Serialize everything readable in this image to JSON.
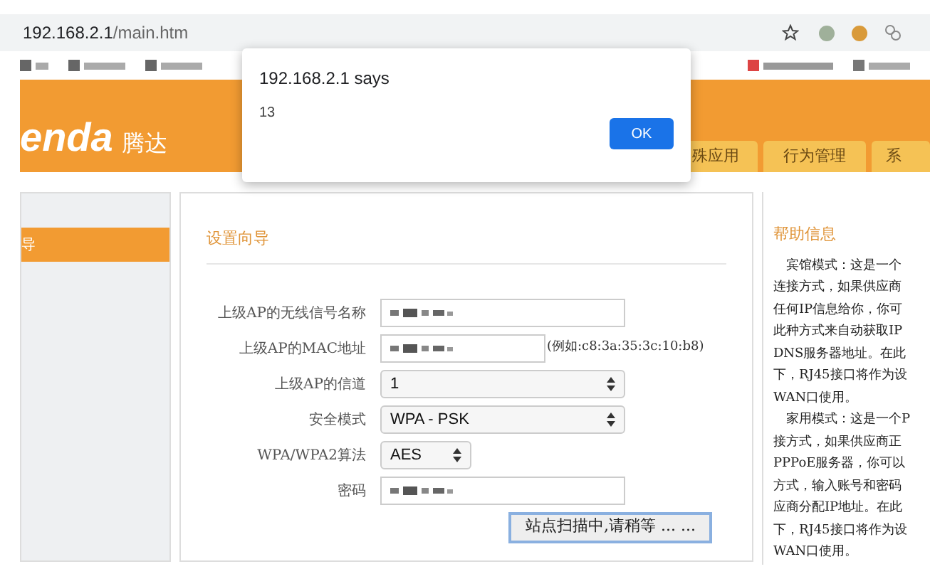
{
  "browser": {
    "url_host": "192.168.2.1",
    "url_path": "/main.htm"
  },
  "header": {
    "logo": "enda",
    "logo_cn": "腾达"
  },
  "tabs": [
    {
      "label": "殊应用",
      "selected": false
    },
    {
      "label": "行为管理",
      "selected": false
    },
    {
      "label": "系",
      "selected": false
    }
  ],
  "sidebar": {
    "items": [
      {
        "label": "导",
        "selected": true
      }
    ]
  },
  "form": {
    "title": "设置向导",
    "fields": [
      {
        "kind": "text",
        "label": "上级AP的无线信号名称",
        "blurred": true
      },
      {
        "kind": "text",
        "label": "上级AP的MAC地址",
        "blurred": true,
        "hint": "(例如:c8:3a:35:3c:10:b8)"
      },
      {
        "kind": "select",
        "label": "上级AP的信道",
        "value": "1"
      },
      {
        "kind": "select",
        "label": "安全模式",
        "value": "WPA - PSK"
      },
      {
        "kind": "select-small",
        "label": "WPA/WPA2算法",
        "value": "AES"
      },
      {
        "kind": "text",
        "label": "密码",
        "blurred": true
      }
    ],
    "scan_button": "站点扫描中,请稍等 ... ..."
  },
  "help": {
    "title": "帮助信息",
    "lines": [
      "　宾馆模式：这是一个",
      "连接方式，如果供应商",
      "任何IP信息给你，你可",
      "此种方式来自动获取IP",
      "DNS服务器地址。在此",
      "下，RJ45接口将作为设",
      "WAN口使用。",
      "　家用模式：这是一个P",
      "接方式，如果供应商正",
      "PPPoE服务器，你可以",
      "方式，输入账号和密码",
      "应商分配IP地址。在此",
      "下，RJ45接口将作为设",
      "WAN口使用。"
    ]
  },
  "dialog": {
    "title": "192.168.2.1 says",
    "message": "13",
    "button": "OK"
  }
}
